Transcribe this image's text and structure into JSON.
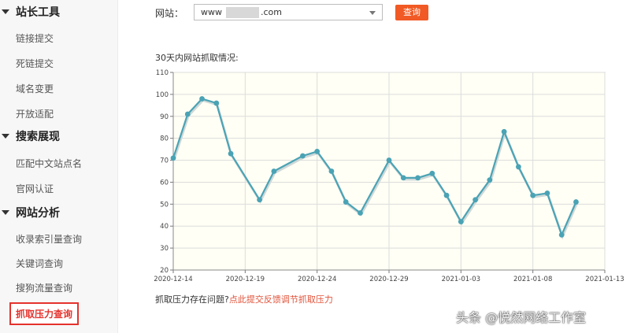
{
  "sidebar": {
    "sections": [
      {
        "title": "站长工具",
        "items": [
          "链接提交",
          "死链提交",
          "域名变更",
          "开放适配"
        ]
      },
      {
        "title": "搜索展现",
        "items": [
          "匹配中文站点名",
          "官网认证"
        ]
      },
      {
        "title": "网站分析",
        "items": [
          "收录索引量查询",
          "关键词查询",
          "搜狗流量查询",
          "抓取压力查询"
        ]
      }
    ],
    "active_item": "抓取压力查询"
  },
  "form": {
    "site_label": "网站：",
    "site_value_prefix": "www",
    "site_value_suffix": ".com",
    "query_button": "查询"
  },
  "chart_caption": "30天内网站抓取情况:",
  "footer": {
    "question": "抓取压力存在问题?",
    "link": "点此提交反馈调节抓取压力"
  },
  "watermark": "头条 @悦然网络工作室",
  "chart_data": {
    "type": "line",
    "title": "",
    "xlabel": "",
    "ylabel": "",
    "ylim": [
      20,
      110
    ],
    "yticks": [
      20,
      30,
      40,
      50,
      60,
      70,
      80,
      90,
      100,
      110
    ],
    "xticks": [
      "2020-12-14",
      "2020-12-19",
      "2020-12-24",
      "2020-12-29",
      "2021-01-03",
      "2021-01-08",
      "2021-01-13"
    ],
    "grid": true,
    "line_color": "#4aa3b5",
    "background": "#fffff5",
    "series": [
      {
        "x": [
          "2020-12-14",
          "2020-12-15",
          "2020-12-16",
          "2020-12-17",
          "2020-12-18",
          "2020-12-20",
          "2020-12-21",
          "2020-12-23",
          "2020-12-24",
          "2020-12-25",
          "2020-12-26",
          "2020-12-27",
          "2020-12-29",
          "2020-12-30",
          "2020-12-31",
          "2021-01-01",
          "2021-01-02",
          "2021-01-03",
          "2021-01-04",
          "2021-01-05",
          "2021-01-06",
          "2021-01-07",
          "2021-01-08",
          "2021-01-09",
          "2021-01-10",
          "2021-01-11"
        ],
        "values": [
          71,
          91,
          98,
          96,
          73,
          52,
          65,
          72,
          74,
          65,
          51,
          46,
          70,
          62,
          62,
          64,
          54,
          42,
          52,
          61,
          83,
          67,
          54,
          55,
          36,
          51
        ]
      }
    ]
  }
}
